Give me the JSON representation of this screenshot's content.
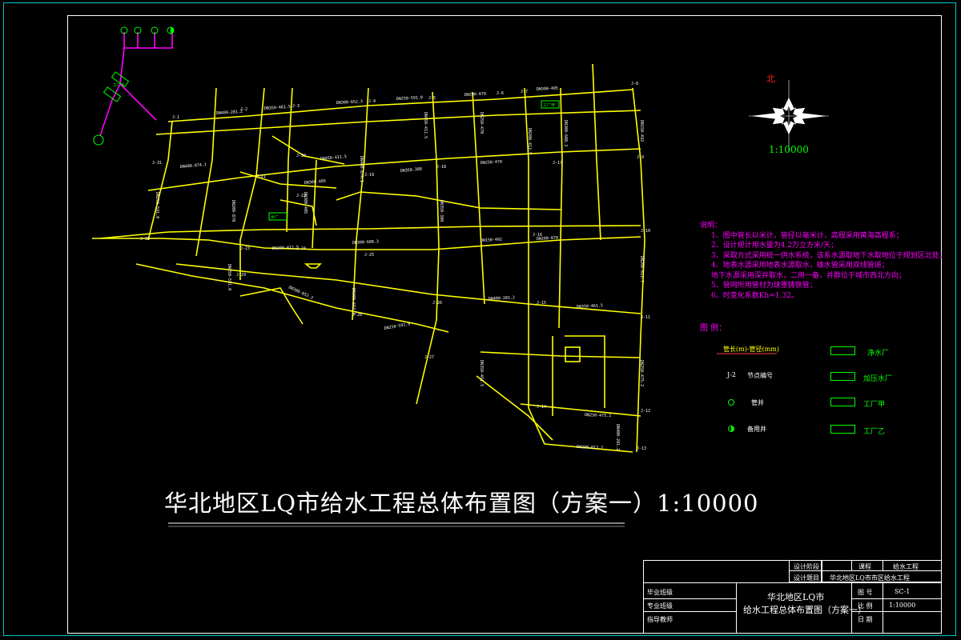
{
  "title": "华北地区LQ市给水工程总体布置图（方案一）1:10000",
  "compass": {
    "north_label": "北",
    "scale": "1:10000"
  },
  "notes": {
    "heading": "说明：",
    "items": [
      "1、图中管长以米计，管径以毫米计，高程采用黄海高程系；",
      "2、设计规计用水量为4.2万立方米/天；",
      "3、采取方式采用统一供水系统，该系水源取地下水取地位于规划区北处；",
      "4、地表水源采用地表水源取水，输水管采用双线管道；",
      "   地下水源采用深井取水，二用一备，并群位于城市西北方向；",
      "5、管网所用管材为球墨铸铁管；",
      "6、时变化系数Kh=1.32。"
    ]
  },
  "legend": {
    "heading": "图  例：",
    "items": [
      {
        "symbol": "line",
        "text": "管长(m)-管径(mm)"
      },
      {
        "symbol": "node",
        "code": "J-2",
        "text": "节点编号"
      },
      {
        "symbol": "well",
        "text": "管井"
      },
      {
        "symbol": "standby-well",
        "text": "备用井"
      }
    ],
    "boxes": [
      "净水厂",
      "加压水厂",
      "工厂甲",
      "工厂乙"
    ]
  },
  "title_block": {
    "row1": {
      "left_label": "设计阶段",
      "right_label": "课程",
      "right_value": "给水工程"
    },
    "row2": {
      "left_label": "设计题目",
      "right_value": "华北地区LQ市市区给水工程"
    },
    "left_col": [
      "毕业班级",
      "专业班级",
      "指导教师"
    ],
    "center": [
      "华北地区LQ市",
      "给水工程总体布置图（方案一）"
    ],
    "right_labels": [
      "图  号",
      "比  例",
      "日  期"
    ],
    "right_values": [
      "SC-1",
      "1:10000",
      ""
    ]
  },
  "map_labels": {
    "nodes": [
      "J-1",
      "J-2",
      "J-3",
      "J-4",
      "J-5",
      "J-6",
      "J-7",
      "J-8",
      "J-9",
      "J-10",
      "J-11",
      "J-12",
      "J-13",
      "J-14",
      "J-15",
      "J-16",
      "J-17",
      "J-18",
      "J-19",
      "J-20",
      "J-21",
      "J-22",
      "J-23",
      "J-24",
      "J-25",
      "J-26",
      "J-27",
      "J-28",
      "J-29",
      "J-30",
      "J-31",
      "J-32",
      "J-33",
      "J-34",
      "J-35",
      "J-36",
      "J-37",
      "J-38",
      "J-39"
    ],
    "pipes": [
      "DN400-281.2",
      "DN350-461.5",
      "DN300-652.3",
      "DN250-591.0",
      "DN200-870",
      "DN300-405",
      "DN400-874.1",
      "DN450-411.5",
      "DN350-380",
      "DN250-470",
      "DN200-412.5",
      "DN300-608.3",
      "DN150-492",
      "DN200-612.7",
      "DN250-475.2"
    ],
    "facilities": [
      "水厂",
      "工厂乙",
      "工厂甲"
    ]
  }
}
